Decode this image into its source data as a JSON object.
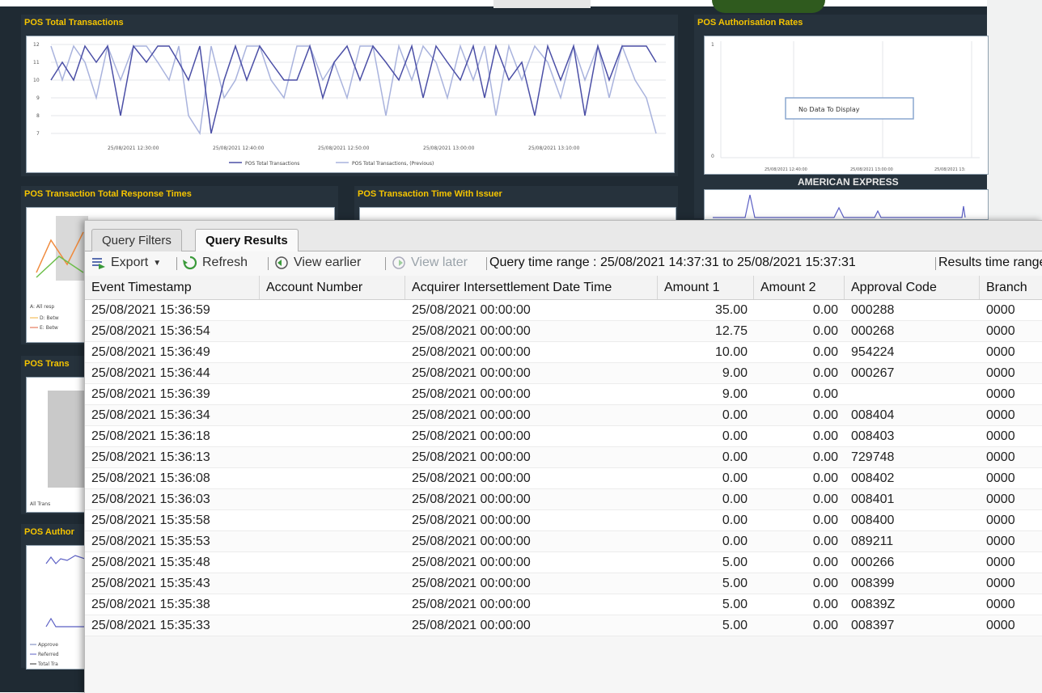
{
  "dashboard": {
    "panels": {
      "total_transactions": {
        "title": "POS Total Transactions",
        "legend": [
          "POS Total Transactions",
          "POS Total Transactions, (Previous)"
        ],
        "x_ticks": [
          "25/08/2021 12:30:00",
          "25/08/2021 12:40:00",
          "25/08/2021 12:50:00",
          "25/08/2021 13:00:00",
          "25/08/2021 13:10:00"
        ],
        "y_ticks": [
          "12",
          "11",
          "10",
          "9",
          "8",
          "7"
        ]
      },
      "auth_rates": {
        "title": "POS Authorisation Rates",
        "message": "No Data To Display",
        "x_ticks": [
          "25/08/2021 12:40:00",
          "25/08/2021 13:00:00",
          "25/08/2021 13:"
        ],
        "y_ticks": [
          "1",
          "0"
        ],
        "subtitle": "AMERICAN EXPRESS"
      },
      "response_times": {
        "title": "POS Transaction Total Response Times",
        "legend": [
          "A: All resp",
          "D: Betw",
          "E: Betw"
        ]
      },
      "time_with_issuer": {
        "title": "POS Transaction Time With Issuer"
      },
      "trans": {
        "title": "POS Trans",
        "legend": [
          "All Trans"
        ]
      },
      "author": {
        "title": "POS Author",
        "legend": [
          "Approve",
          "Referred",
          "Total Tra"
        ]
      }
    }
  },
  "query_window": {
    "tabs": [
      {
        "label": "Query Filters",
        "active": false
      },
      {
        "label": "Query Results",
        "active": true
      }
    ],
    "toolbar": {
      "export": "Export",
      "refresh": "Refresh",
      "view_earlier": "View earlier",
      "view_later": "View later",
      "query_time_range": "Query time range : 25/08/2021 14:37:31 to 25/08/2021 15:37:31",
      "results_time_range": "Results time range :"
    },
    "columns": [
      "Event Timestamp",
      "Account Number",
      "Acquirer Intersettlement Date Time",
      "Amount 1",
      "Amount 2",
      "Approval Code",
      "Branch"
    ],
    "rows": [
      [
        "25/08/2021 15:36:59",
        "",
        "25/08/2021 00:00:00",
        "35.00",
        "0.00",
        "000288",
        "0000"
      ],
      [
        "25/08/2021 15:36:54",
        "",
        "25/08/2021 00:00:00",
        "12.75",
        "0.00",
        "000268",
        "0000"
      ],
      [
        "25/08/2021 15:36:49",
        "",
        "25/08/2021 00:00:00",
        "10.00",
        "0.00",
        "954224",
        "0000"
      ],
      [
        "25/08/2021 15:36:44",
        "",
        "25/08/2021 00:00:00",
        "9.00",
        "0.00",
        "000267",
        "0000"
      ],
      [
        "25/08/2021 15:36:39",
        "",
        "25/08/2021 00:00:00",
        "9.00",
        "0.00",
        "",
        "0000"
      ],
      [
        "25/08/2021 15:36:34",
        "",
        "25/08/2021 00:00:00",
        "0.00",
        "0.00",
        "008404",
        "0000"
      ],
      [
        "25/08/2021 15:36:18",
        "",
        "25/08/2021 00:00:00",
        "0.00",
        "0.00",
        "008403",
        "0000"
      ],
      [
        "25/08/2021 15:36:13",
        "",
        "25/08/2021 00:00:00",
        "0.00",
        "0.00",
        "729748",
        "0000"
      ],
      [
        "25/08/2021 15:36:08",
        "",
        "25/08/2021 00:00:00",
        "0.00",
        "0.00",
        "008402",
        "0000"
      ],
      [
        "25/08/2021 15:36:03",
        "",
        "25/08/2021 00:00:00",
        "0.00",
        "0.00",
        "008401",
        "0000"
      ],
      [
        "25/08/2021 15:35:58",
        "",
        "25/08/2021 00:00:00",
        "0.00",
        "0.00",
        "008400",
        "0000"
      ],
      [
        "25/08/2021 15:35:53",
        "",
        "25/08/2021 00:00:00",
        "0.00",
        "0.00",
        "089211",
        "0000"
      ],
      [
        "25/08/2021 15:35:48",
        "",
        "25/08/2021 00:00:00",
        "5.00",
        "0.00",
        "000266",
        "0000"
      ],
      [
        "25/08/2021 15:35:43",
        "",
        "25/08/2021 00:00:00",
        "5.00",
        "0.00",
        "008399",
        "0000"
      ],
      [
        "25/08/2021 15:35:38",
        "",
        "25/08/2021 00:00:00",
        "5.00",
        "0.00",
        "00839Z",
        "0000"
      ],
      [
        "25/08/2021 15:35:33",
        "",
        "25/08/2021 00:00:00",
        "5.00",
        "0.00",
        "008397",
        "0000"
      ]
    ]
  }
}
